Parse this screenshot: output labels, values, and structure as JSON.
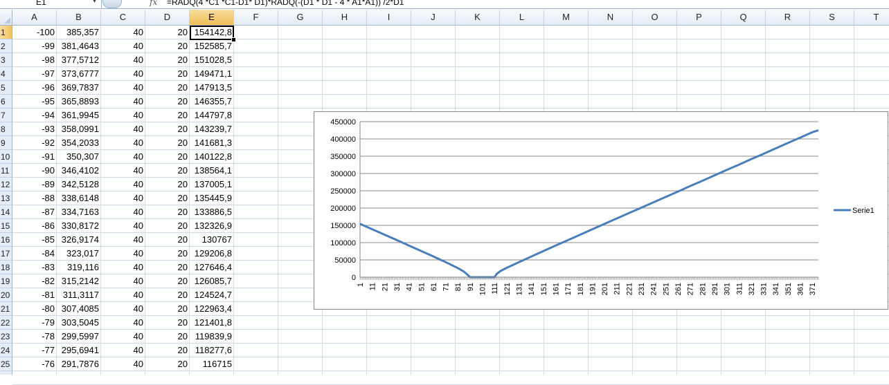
{
  "formula_bar": {
    "name_box": "E1",
    "fx": "fx",
    "formula": "=RADQ(4 *C1 *C1-D1* D1)*RADQ(-(D1 * D1 - 4 * A1*A1)) /2*D1"
  },
  "columns": [
    "A",
    "B",
    "C",
    "D",
    "E",
    "F",
    "G",
    "H",
    "I",
    "J",
    "K",
    "L",
    "M",
    "N",
    "O",
    "P",
    "Q",
    "R",
    "S",
    "T"
  ],
  "active_column": "E",
  "active_row": 1,
  "rows": [
    {
      "n": "1",
      "a": "-100",
      "b": "385,357",
      "c": "40",
      "d": "20",
      "e": "154142,8"
    },
    {
      "n": "2",
      "a": "-99",
      "b": "381,4643",
      "c": "40",
      "d": "20",
      "e": "152585,7"
    },
    {
      "n": "3",
      "a": "-98",
      "b": "377,5712",
      "c": "40",
      "d": "20",
      "e": "151028,5"
    },
    {
      "n": "4",
      "a": "-97",
      "b": "373,6777",
      "c": "40",
      "d": "20",
      "e": "149471,1"
    },
    {
      "n": "5",
      "a": "-96",
      "b": "369,7837",
      "c": "40",
      "d": "20",
      "e": "147913,5"
    },
    {
      "n": "6",
      "a": "-95",
      "b": "365,8893",
      "c": "40",
      "d": "20",
      "e": "146355,7"
    },
    {
      "n": "7",
      "a": "-94",
      "b": "361,9945",
      "c": "40",
      "d": "20",
      "e": "144797,8"
    },
    {
      "n": "8",
      "a": "-93",
      "b": "358,0991",
      "c": "40",
      "d": "20",
      "e": "143239,7"
    },
    {
      "n": "9",
      "a": "-92",
      "b": "354,2033",
      "c": "40",
      "d": "20",
      "e": "141681,3"
    },
    {
      "n": "10",
      "a": "-91",
      "b": "350,307",
      "c": "40",
      "d": "20",
      "e": "140122,8"
    },
    {
      "n": "11",
      "a": "-90",
      "b": "346,4102",
      "c": "40",
      "d": "20",
      "e": "138564,1"
    },
    {
      "n": "12",
      "a": "-89",
      "b": "342,5128",
      "c": "40",
      "d": "20",
      "e": "137005,1"
    },
    {
      "n": "13",
      "a": "-88",
      "b": "338,6148",
      "c": "40",
      "d": "20",
      "e": "135445,9"
    },
    {
      "n": "14",
      "a": "-87",
      "b": "334,7163",
      "c": "40",
      "d": "20",
      "e": "133886,5"
    },
    {
      "n": "15",
      "a": "-86",
      "b": "330,8172",
      "c": "40",
      "d": "20",
      "e": "132326,9"
    },
    {
      "n": "16",
      "a": "-85",
      "b": "326,9174",
      "c": "40",
      "d": "20",
      "e": "130767"
    },
    {
      "n": "17",
      "a": "-84",
      "b": "323,017",
      "c": "40",
      "d": "20",
      "e": "129206,8"
    },
    {
      "n": "18",
      "a": "-83",
      "b": "319,116",
      "c": "40",
      "d": "20",
      "e": "127646,4"
    },
    {
      "n": "19",
      "a": "-82",
      "b": "315,2142",
      "c": "40",
      "d": "20",
      "e": "126085,7"
    },
    {
      "n": "20",
      "a": "-81",
      "b": "311,3117",
      "c": "40",
      "d": "20",
      "e": "124524,7"
    },
    {
      "n": "21",
      "a": "-80",
      "b": "307,4085",
      "c": "40",
      "d": "20",
      "e": "122963,4"
    },
    {
      "n": "22",
      "a": "-79",
      "b": "303,5045",
      "c": "40",
      "d": "20",
      "e": "121401,8"
    },
    {
      "n": "23",
      "a": "-78",
      "b": "299,5997",
      "c": "40",
      "d": "20",
      "e": "119839,9"
    },
    {
      "n": "24",
      "a": "-77",
      "b": "295,6941",
      "c": "40",
      "d": "20",
      "e": "118277,6"
    },
    {
      "n": "25",
      "a": "-76",
      "b": "291,7876",
      "c": "40",
      "d": "20",
      "e": "116715"
    }
  ],
  "chart_data": {
    "type": "line",
    "title": "",
    "xlabel": "",
    "ylabel": "",
    "ylim": [
      0,
      450000
    ],
    "yticks": [
      "450000",
      "400000",
      "350000",
      "300000",
      "250000",
      "200000",
      "150000",
      "100000",
      "50000",
      "0"
    ],
    "xticks": [
      "1",
      "11",
      "21",
      "31",
      "41",
      "51",
      "61",
      "71",
      "81",
      "91",
      "101",
      "111",
      "121",
      "131",
      "141",
      "151",
      "161",
      "171",
      "181",
      "191",
      "201",
      "211",
      "221",
      "231",
      "241",
      "251",
      "261",
      "271",
      "281",
      "291",
      "301",
      "311",
      "321",
      "331",
      "341",
      "351",
      "361",
      "371"
    ],
    "xlim": [
      1,
      376
    ],
    "grid": true,
    "legend": "right",
    "series": [
      {
        "name": "Serie1",
        "color": "#4a7ebb",
        "points": [
          {
            "x": 1,
            "y": 154143
          },
          {
            "x": 11,
            "y": 138564
          },
          {
            "x": 21,
            "y": 122963
          },
          {
            "x": 31,
            "y": 107335
          },
          {
            "x": 41,
            "y": 91652
          },
          {
            "x": 51,
            "y": 75900
          },
          {
            "x": 61,
            "y": 59980
          },
          {
            "x": 71,
            "y": 43700
          },
          {
            "x": 81,
            "y": 26500
          },
          {
            "x": 86,
            "y": 16000
          },
          {
            "x": 89,
            "y": 7000
          },
          {
            "x": 91,
            "y": 0
          },
          {
            "x": 111,
            "y": 0
          },
          {
            "x": 113,
            "y": 10000
          },
          {
            "x": 116,
            "y": 18000
          },
          {
            "x": 121,
            "y": 27000
          },
          {
            "x": 131,
            "y": 43500
          },
          {
            "x": 141,
            "y": 59500
          },
          {
            "x": 151,
            "y": 75500
          },
          {
            "x": 161,
            "y": 91500
          },
          {
            "x": 171,
            "y": 107000
          },
          {
            "x": 181,
            "y": 122800
          },
          {
            "x": 191,
            "y": 138500
          },
          {
            "x": 201,
            "y": 154100
          },
          {
            "x": 211,
            "y": 169700
          },
          {
            "x": 221,
            "y": 185300
          },
          {
            "x": 231,
            "y": 200900
          },
          {
            "x": 241,
            "y": 216500
          },
          {
            "x": 251,
            "y": 232100
          },
          {
            "x": 261,
            "y": 247700
          },
          {
            "x": 271,
            "y": 263300
          },
          {
            "x": 281,
            "y": 278900
          },
          {
            "x": 291,
            "y": 294500
          },
          {
            "x": 301,
            "y": 310100
          },
          {
            "x": 311,
            "y": 325700
          },
          {
            "x": 321,
            "y": 341300
          },
          {
            "x": 331,
            "y": 356900
          },
          {
            "x": 341,
            "y": 372500
          },
          {
            "x": 351,
            "y": 388100
          },
          {
            "x": 361,
            "y": 403700
          },
          {
            "x": 371,
            "y": 419300
          },
          {
            "x": 376,
            "y": 425000
          }
        ]
      }
    ]
  }
}
